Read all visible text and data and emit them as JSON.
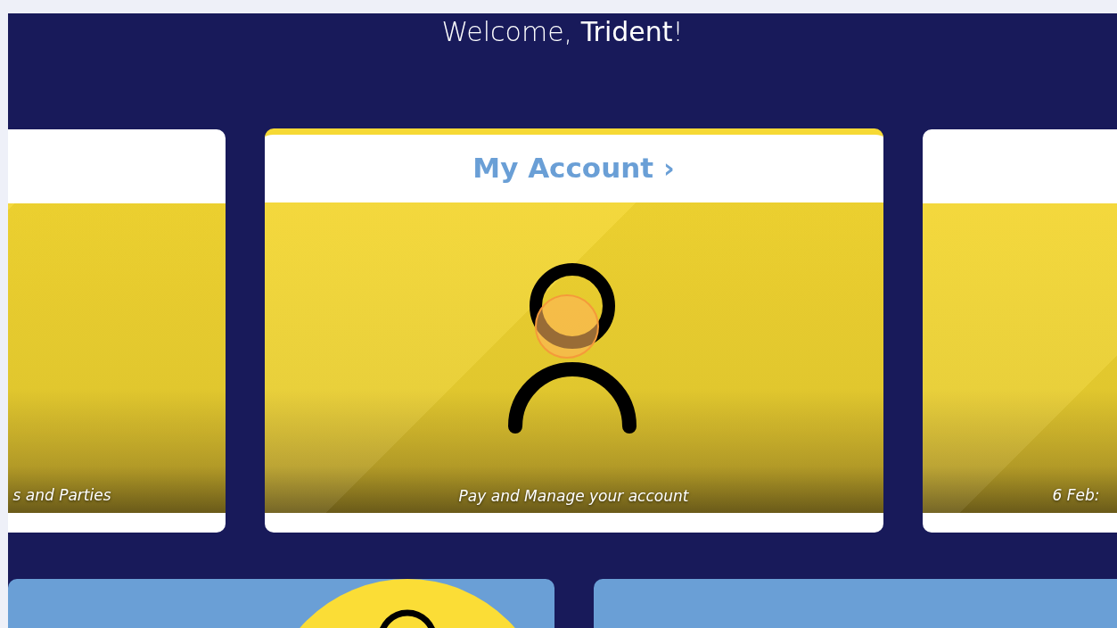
{
  "welcome": "Welcome, **Trident**!",
  "cards": [
    {
      "caption": "s and Parties",
      "selected": false,
      "kind": "partial"
    },
    {
      "title": "My Account ›",
      "caption": "Pay and Manage your account",
      "selected": true,
      "kind": "person"
    },
    {
      "caption": "6 Feb:",
      "selected": false,
      "kind": "blank"
    }
  ],
  "tiles": [
    {
      "kind": "badge"
    },
    {
      "kind": "plain"
    }
  ]
}
